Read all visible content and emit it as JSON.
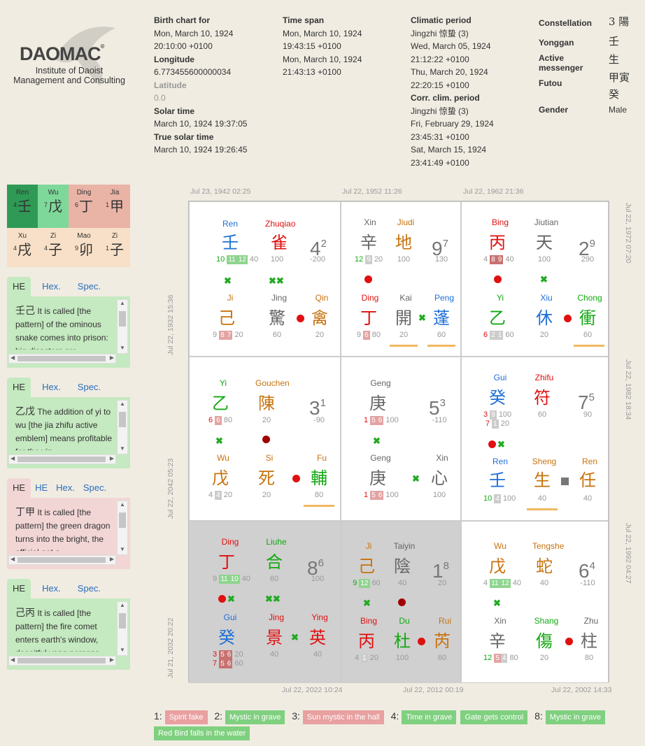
{
  "logo": {
    "brand": "DAOMAC",
    "reg": "®",
    "line1": "Institute of Daoist",
    "line2": "Management and Consulting"
  },
  "birth": {
    "h1": "Birth chart for",
    "v1": "Mon, March 10, 1924",
    "v2": "20:10:00 +0100",
    "h_lon": "Longitude",
    "lon": "6.773455600000034",
    "h_lat": "Latitude",
    "lat": "0.0",
    "h_solar": "Solar time",
    "solar": "March 10, 1924 19:37:05",
    "h_true": "True solar time",
    "truesolar": "March 10, 1924 19:26:45"
  },
  "timespan": {
    "h": "Time span",
    "a1": "Mon, March 10, 1924",
    "a2": "19:43:15 +0100",
    "b1": "Mon, March 10, 1924",
    "b2": "21:43:13 +0100"
  },
  "climatic": {
    "h": "Climatic period",
    "a0": "Jingzhi 惊蛰 (3)",
    "a1": "Wed, March 05, 1924",
    "a2": "21:12:22 +0100",
    "a3": "Thu, March 20, 1924",
    "a4": "22:20:15 +0100",
    "h2": "Corr. clim. period",
    "b0": "Jingzhi 惊蛰 (3)",
    "b1": "Fri, February 29, 1924",
    "b2": "23:45:31 +0100",
    "b3": "Sat, March 15, 1924",
    "b4": "23:41:49 +0100"
  },
  "summary": {
    "k1": "Constellation",
    "v1": "3 陽",
    "k2": "Yonggan",
    "v2": "壬",
    "k3": "Active messenger",
    "v3": "生",
    "v3b": "甲寅",
    "k4": "Futou",
    "v4": "癸",
    "k5": "Gender",
    "v5": "Male"
  },
  "pillars": {
    "top": [
      {
        "l": "Ren",
        "n": "4",
        "c": "壬"
      },
      {
        "l": "Wu",
        "n": "7",
        "c": "戊"
      },
      {
        "l": "Ding",
        "n": "6",
        "c": "丁"
      },
      {
        "l": "Jia",
        "n": "1",
        "c": "甲"
      }
    ],
    "bottom": [
      {
        "l": "Xu",
        "n": "4",
        "c": "戌"
      },
      {
        "l": "Zi",
        "n": "4",
        "c": "子"
      },
      {
        "l": "Mao",
        "n": "9",
        "c": "卯"
      },
      {
        "l": "Zi",
        "n": "1",
        "c": "子"
      }
    ]
  },
  "panels": [
    {
      "tabs": [
        "HE",
        "Hex.",
        "Spec."
      ],
      "cz": "壬己",
      "text": "It is called [the pattern] of the ominous snake comes into prison: big disasters are"
    },
    {
      "tabs": [
        "HE",
        "Hex.",
        "Spec."
      ],
      "cz": "乙戊",
      "text": "The addition of yi to wu [the jia zhifu active emblem] means profitable for the yin"
    },
    {
      "tabs": [
        "HE",
        "HE",
        "Hex.",
        "Spec."
      ],
      "cz": "丁甲",
      "text": "It is called [the pattern] the green dragon turns into the bright, the official get a"
    },
    {
      "tabs": [
        "HE",
        "Hex.",
        "Spec."
      ],
      "cz": "己丙",
      "text": "It is called [the pattern] the fire comet enters earth's window, deceitful yang persons"
    }
  ],
  "dates": {
    "t1": "Jul 23, 1942 02:25",
    "t2": "Jul 22, 1952 11:26",
    "t3": "Jul 22, 1962 21:36",
    "r1": "Jul 22, 1972 07:20",
    "r2": "Jul 22, 1982 18:34",
    "r3": "Jul 22, 1992 04:27",
    "b1": "Jul 22, 2022 10:24",
    "b2": "Jul 22, 2012 00:19",
    "b3": "Jul 22, 2002 14:33",
    "l1": "Jul 22, 1932 15:36",
    "l2": "Jul 22, 2042 05:23",
    "l3": "Jul 21, 2032 20:22"
  },
  "cells": {
    "c1": {
      "n1": "Ren",
      "c1": "壬",
      "n2": "Zhuqiao",
      "c2": "雀",
      "big": "4",
      "sup": "2",
      "v2": "100",
      "v3": "-200",
      "b1": "10",
      "bx": [
        "11",
        "12"
      ],
      "b2": "40",
      "n3": "Ji",
      "c3": "己",
      "n4": "Jing",
      "c4": "驚",
      "n5": "Qin",
      "c5": "禽",
      "p3": "9",
      "px3": [
        "8",
        "7"
      ],
      "p3b": "20",
      "v4": "60",
      "v5": "20"
    },
    "c2": {
      "n1": "Xin",
      "c1": "辛",
      "n2": "Jiudi",
      "c2": "地",
      "big": "9",
      "sup": "7",
      "v2": "100",
      "v3": "130",
      "b1": "12",
      "bx": [
        "9"
      ],
      "b2": "20",
      "n3": "Ding",
      "c3": "丁",
      "n4": "Kai",
      "c4": "開",
      "n5": "Peng",
      "c5": "蓬",
      "p3": "9",
      "px3": [
        "6"
      ],
      "p3b": "80",
      "v4": "20",
      "v5": "60"
    },
    "c3": {
      "n1": "Bing",
      "c1": "丙",
      "n2": "Jiutian",
      "c2": "天",
      "big": "2",
      "sup": "9",
      "v2": "100",
      "v3": "290",
      "b1": "4",
      "bx": [
        "8",
        "9"
      ],
      "b2": "40",
      "n3": "Yi",
      "c3": "乙",
      "n4": "Xiu",
      "c4": "休",
      "n5": "Chong",
      "c5": "衝",
      "p3": "6",
      "px3": [
        "2",
        "1"
      ],
      "p3b": "60",
      "v4": "20",
      "v5": "60"
    },
    "c4": {
      "n1": "Yi",
      "c1": "乙",
      "n2": "Gouchen",
      "c2": "陳",
      "big": "3",
      "sup": "1",
      "v2": "20",
      "v3": "-90",
      "b1": "6",
      "bx": [
        "6"
      ],
      "b2": "80",
      "n3": "Wu",
      "c3": "戊",
      "n4": "Si",
      "c4": "死",
      "n5": "Fu",
      "c5": "輔",
      "p3": "4",
      "px3": [
        "4"
      ],
      "p3b": "20",
      "v4": "20",
      "v5": "80"
    },
    "c5": {
      "n1": "Geng",
      "c1": "庚",
      "big": "5",
      "sup": "3",
      "v3": "-110",
      "b1": "1",
      "bx": [
        "5",
        "6"
      ],
      "b2": "100",
      "n3": "Geng",
      "c3": "庚",
      "n5": "Xin",
      "c5": "心",
      "p3": "1",
      "px3": [
        "5",
        "6"
      ],
      "p3b": "100",
      "v5": "100"
    },
    "c6": {
      "n1": "Gui",
      "c1": "癸",
      "n2": "Zhifu",
      "c2": "符",
      "big": "7",
      "sup": "5",
      "v2": "60",
      "v3": "90",
      "b1": "3",
      "bx": [
        "9"
      ],
      "b2": "100",
      "b1b": "7",
      "bxb": [
        "1"
      ],
      "b2b": "20",
      "n3": "Ren",
      "c3": "壬",
      "n4": "Sheng",
      "c4": "生",
      "n5": "Ren",
      "c5": "任",
      "p3": "10",
      "px3": [
        "4"
      ],
      "p3b": "100",
      "v4": "40",
      "v5": "40"
    },
    "c7": {
      "n1": "Ding",
      "c1": "丁",
      "n2": "Liuhe",
      "c2": "合",
      "big": "8",
      "sup": "6",
      "v2": "60",
      "v3": "100",
      "b1": "9",
      "bx": [
        "11",
        "10"
      ],
      "b2": "40",
      "n3": "Gui",
      "c3": "癸",
      "n4": "Jing",
      "c4": "景",
      "n5": "Ying",
      "c5": "英",
      "p3": "3",
      "px3": [
        "5",
        "6"
      ],
      "p3b": "20",
      "p3c": "7",
      "px3c": [
        "5",
        "6"
      ],
      "p3d": "60",
      "v4": "40",
      "v5": "40"
    },
    "c8": {
      "n1": "Ji",
      "c1": "己",
      "n2": "Taiyin",
      "c2": "陰",
      "big": "1",
      "sup": "8",
      "v2": "40",
      "v3": "20",
      "b1": "9",
      "bx": [
        "12"
      ],
      "b2": "60",
      "n3": "Bing",
      "c3": "丙",
      "n4": "Du",
      "c4": "杜",
      "n5": "Rui",
      "c5": "芮",
      "p3": "4",
      "px3": [
        "1"
      ],
      "p3b": "20",
      "v4": "100",
      "v5": "60"
    },
    "c9": {
      "n1": "Wu",
      "c1": "戊",
      "n2": "Tengshe",
      "c2": "蛇",
      "big": "6",
      "sup": "4",
      "v2": "40",
      "v3": "-110",
      "b1": "4",
      "bx": [
        "11",
        "12"
      ],
      "b2": "40",
      "n3": "Xin",
      "c3": "辛",
      "n4": "Shang",
      "c4": "傷",
      "n5": "Zhu",
      "c5": "柱",
      "p3": "12",
      "px3": [
        "5",
        "4"
      ],
      "p3b": "80",
      "v4": "20",
      "v5": "80"
    }
  },
  "footer": [
    {
      "n": "1:",
      "labels": [
        "Spirit fake"
      ],
      "colors": [
        "#e8a0a0"
      ]
    },
    {
      "n": "2:",
      "labels": [
        "Mystic in grave"
      ],
      "colors": [
        "#7fd07f"
      ]
    },
    {
      "n": "3:",
      "labels": [
        "Sun mystic in the hall"
      ],
      "colors": [
        "#e8a0a0"
      ]
    },
    {
      "n": "4:",
      "labels": [
        "Time in grave",
        "Gate gets control"
      ],
      "colors": [
        "#7fd07f",
        "#7fd07f"
      ]
    },
    {
      "n": "8:",
      "labels": [
        "Mystic in grave",
        "Red Bird falls in the water"
      ],
      "colors": [
        "#7fd07f",
        "#7fd07f"
      ]
    }
  ],
  "colors": {
    "red": "#e01010",
    "blue": "#1e6fd8",
    "green": "#12a812",
    "brown": "#c8720d",
    "gray_cell": "#d0d0d0"
  }
}
